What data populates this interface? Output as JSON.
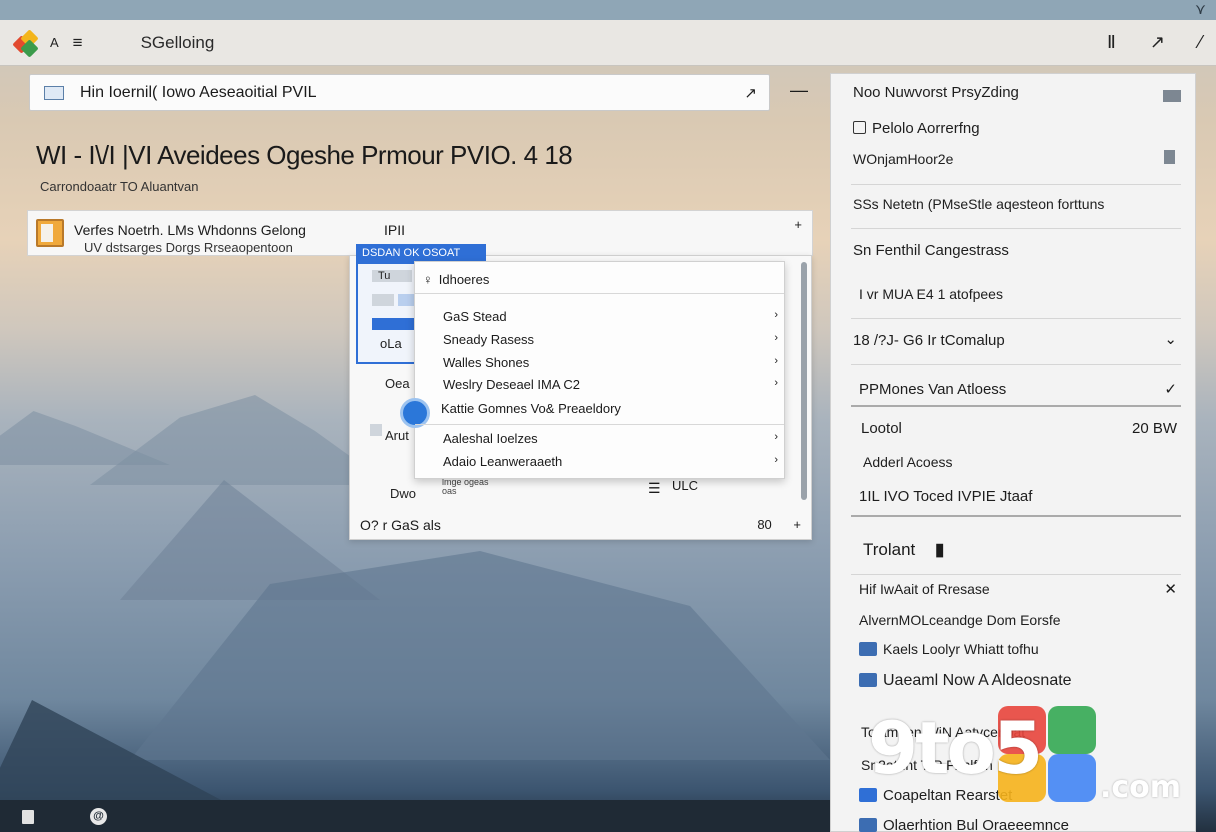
{
  "titlebar": {
    "menu_a": "A",
    "menu_hamburger": "≡",
    "title": "SGelloing",
    "right_icons": [
      "pin-icon",
      "pen-icon",
      "pen-alt-icon"
    ],
    "right_glyphs": [
      "Ⅱ",
      "↗",
      "⁄"
    ]
  },
  "address": {
    "value": "Hin Ioernil( Iowo Aeseaoitial PVIL",
    "go": "↗",
    "side_button": "—"
  },
  "main": {
    "heading": "WI - I\\/I |VI Aveidees Ogeshe Prmour PVIO. 4 18",
    "subheading": "Carrondoaatr TO Aluantvan"
  },
  "file": {
    "name": "Verfes Noetrh. LMs Whdonns Gelong",
    "sub": "UV dstsarges Dorgs Rrseaopentoon",
    "tag": "IPII",
    "add": "+"
  },
  "dialog": {
    "tab": "DSDAN OK OSOAT",
    "left_labels": [
      "Tu",
      "oLa",
      "Oea",
      "Arut",
      "Dwo"
    ],
    "bottom_left": "O? r GaS als",
    "bottom_right": "80",
    "bottom_plus": "+",
    "ulc": "ULC",
    "eq": "☰",
    "small_lines": [
      "lmge ogeas",
      "oas"
    ]
  },
  "menu": {
    "head": "Idhoeres",
    "items": [
      {
        "label": "GaS Stead",
        "arrow": "›"
      },
      {
        "label": "Sneady Rasess",
        "arrow": "›"
      },
      {
        "label": "Walles Shones",
        "arrow": "›"
      },
      {
        "label": "Weslry Deseael IMA   C2",
        "arrow": "›"
      },
      {
        "label": "Kattie Gomnes Vo&  Preaeldory",
        "arrow": ""
      },
      {
        "label": "Aaleshal Ioelzes",
        "arrow": "›"
      },
      {
        "label": "Adaio Leanweraaeth",
        "arrow": "›"
      }
    ]
  },
  "panel": {
    "rows": [
      {
        "label": "Noo Nuwvorst PrsyZding",
        "right": ""
      },
      {
        "label": "Pelolo Aorrerfng",
        "right": ""
      },
      {
        "label": "WOnjamHoor2e",
        "right": ""
      },
      {
        "label": "SSs Netetn (PMseStle aqesteon forttuns",
        "right": ""
      },
      {
        "label": "Sn Fenthil Cangestrass",
        "right": ""
      },
      {
        "label": "I vr MUA E4 1 atofpees",
        "right": ""
      },
      {
        "label": "18 /?J- G6 Ir tComalup",
        "right": "⌄"
      },
      {
        "label": "PPMones Van Atloess",
        "right": "✓"
      },
      {
        "label": "Lootol",
        "right": "20 BW"
      },
      {
        "label": "Adderl Acoess",
        "right": ""
      },
      {
        "label": "1IL IVO Toced IVPIE Jtaaf",
        "right": ""
      }
    ],
    "section_title": "Trolant",
    "section_mark": "▮",
    "list": [
      {
        "label": "Hif IwAait of Rresase",
        "right": "✕"
      },
      {
        "label": "AlvernMOLceandge Dom Eorsfe",
        "right": ""
      },
      {
        "label": "Kaels Loolyr Whiatt tofhu",
        "right": ""
      },
      {
        "label": "Uaeaml Now A Aldeosnate",
        "right": ""
      },
      {
        "label": "Tolamaen WiN Aatvcenbat",
        "right": ""
      },
      {
        "label": "Sn2atunt TIP Fnnlfen",
        "right": ""
      },
      {
        "label": "Coapeltan Rearstet",
        "right": ""
      },
      {
        "label": "Olaerhtion  Bul Oraeeemnce",
        "right": ""
      }
    ]
  },
  "watermark": {
    "text": "9to5",
    "domain": ".com",
    "colors": [
      "#e8453c",
      "#f6b21b",
      "#34a853",
      "#4285f4"
    ]
  },
  "taskbar": {
    "icon2": "@"
  }
}
